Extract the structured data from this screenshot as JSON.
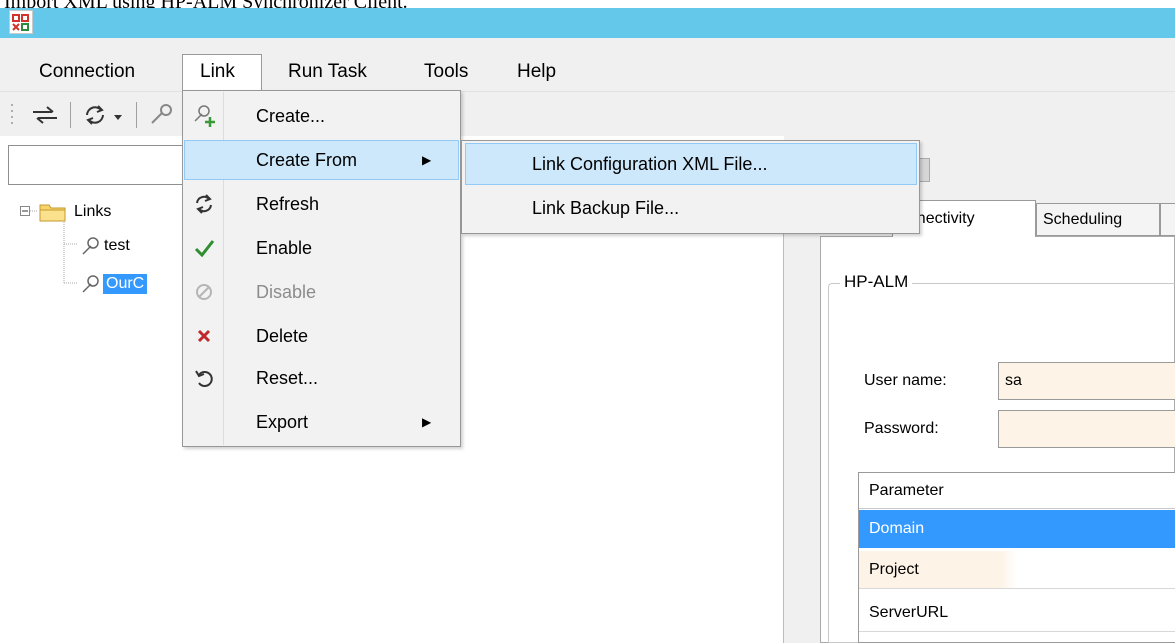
{
  "caption": "Import XML using HP-ALM Synchronizer Client.",
  "menubar": {
    "items": [
      "Connection",
      "Link",
      "Run Task",
      "Tools",
      "Help"
    ]
  },
  "tree": {
    "root": "Links",
    "items": [
      "test",
      "OurC"
    ]
  },
  "link_menu": {
    "items": [
      {
        "label": "Create...",
        "icon": "create-link-icon",
        "enabled": true
      },
      {
        "label": "Create From",
        "icon": "",
        "enabled": true,
        "submenu": true
      },
      {
        "label": "Refresh",
        "icon": "refresh-icon",
        "enabled": true
      },
      {
        "label": "Enable",
        "icon": "check-icon",
        "enabled": true
      },
      {
        "label": "Disable",
        "icon": "disable-icon",
        "enabled": false
      },
      {
        "label": "Delete",
        "icon": "delete-x-icon",
        "enabled": true
      },
      {
        "label": "Reset...",
        "icon": "reset-icon",
        "enabled": true
      },
      {
        "label": "Export",
        "icon": "",
        "enabled": true,
        "submenu": true
      }
    ]
  },
  "create_from_submenu": {
    "items": [
      "Link Configuration XML File...",
      "Link Backup File..."
    ]
  },
  "tabs": [
    "onnectivity",
    "Scheduling"
  ],
  "group": {
    "title": "HP-ALM",
    "username_label": "User name:",
    "username_value": "sa",
    "password_label": "Password:",
    "password_value": ""
  },
  "param_grid": {
    "header": "Parameter",
    "rows": [
      "Domain",
      "Project",
      "ServerURL"
    ]
  },
  "colors": {
    "titlebar": "#63c8ea",
    "menu_highlight": "#cde8fb",
    "selection": "#3399ff",
    "input_bg": "#fdf3e7"
  }
}
